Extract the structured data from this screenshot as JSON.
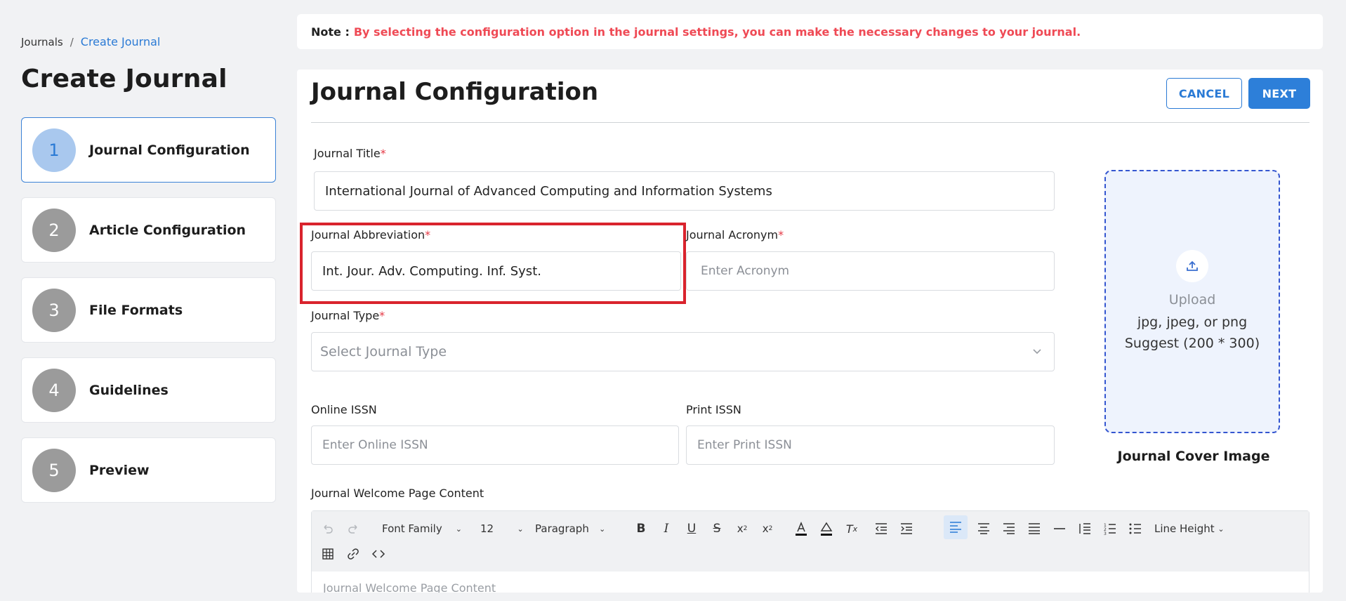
{
  "breadcrumb": {
    "root": "Journals",
    "separator": "/",
    "current": "Create Journal"
  },
  "page_title": "Create Journal",
  "steps": [
    {
      "num": "1",
      "label": "Journal Configuration"
    },
    {
      "num": "2",
      "label": "Article Configuration"
    },
    {
      "num": "3",
      "label": "File Formats"
    },
    {
      "num": "4",
      "label": "Guidelines"
    },
    {
      "num": "5",
      "label": "Preview"
    }
  ],
  "note": {
    "label": "Note :",
    "text": "By selecting the configuration option in the journal settings, you can make the necessary changes to your journal."
  },
  "panel": {
    "title": "Journal Configuration",
    "cancel_label": "CANCEL",
    "next_label": "NEXT"
  },
  "form": {
    "title_label": "Journal Title",
    "title_value": "International Journal of Advanced Computing and Information Systems",
    "abbrev_label": "Journal Abbreviation",
    "abbrev_value": "Int. Jour. Adv. Computing. Inf. Syst.",
    "acronym_label": "Journal Acronym",
    "acronym_placeholder": "Enter Acronym",
    "type_label": "Journal Type",
    "type_placeholder": "Select Journal Type",
    "online_issn_label": "Online ISSN",
    "online_issn_placeholder": "Enter Online ISSN",
    "print_issn_label": "Print ISSN",
    "print_issn_placeholder": "Enter Print ISSN",
    "required_mark": "*"
  },
  "upload": {
    "title": "Upload",
    "formats": "jpg, jpeg, or png",
    "suggest": "Suggest (200 * 300)",
    "caption": "Journal Cover Image"
  },
  "editor": {
    "label": "Journal Welcome Page Content",
    "font_family": "Font Family",
    "font_size": "12",
    "block_format": "Paragraph",
    "line_height": "Line Height",
    "body_placeholder": "Journal Welcome Page Content"
  },
  "colors": {
    "accent": "#2d7fd9",
    "note_text": "#ef4a55",
    "highlight": "#d9232d",
    "required": "#e53945"
  }
}
